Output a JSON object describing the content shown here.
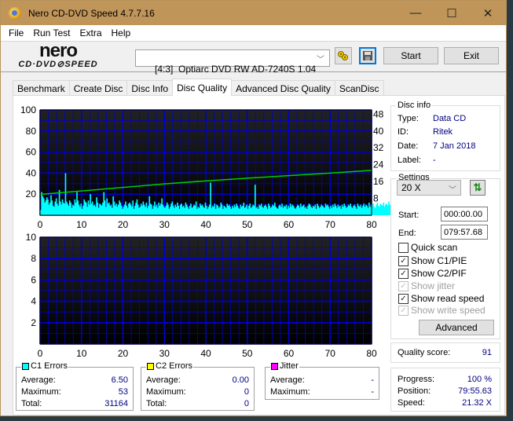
{
  "window": {
    "title": "Nero CD-DVD Speed 4.7.7.16",
    "controls": {
      "minimize": "—",
      "maximize": "☐",
      "close": "✕"
    }
  },
  "menu": [
    "File",
    "Run Test",
    "Extra",
    "Help"
  ],
  "toolbar": {
    "logo_top": "nero",
    "logo_bottom": "CD·DVD⊘SPEED",
    "drive": "[4:3]  Optiarc DVD RW AD-7240S 1.04",
    "start_label": "Start",
    "exit_label": "Exit",
    "icons": [
      "eject-icon",
      "save-icon"
    ]
  },
  "tabs": [
    {
      "label": "Benchmark",
      "active": false
    },
    {
      "label": "Create Disc",
      "active": false
    },
    {
      "label": "Disc Info",
      "active": false
    },
    {
      "label": "Disc Quality",
      "active": true
    },
    {
      "label": "Advanced Disc Quality",
      "active": false
    },
    {
      "label": "ScanDisc",
      "active": false
    }
  ],
  "disc_info": {
    "title": "Disc info",
    "type_label": "Type:",
    "type": "Data CD",
    "id_label": "ID:",
    "id": "Ritek",
    "date_label": "Date:",
    "date": "7 Jan 2018",
    "label_label": "Label:",
    "label": "-"
  },
  "settings": {
    "title": "Settings",
    "speed": "20 X",
    "start_label": "Start:",
    "start": "000:00.00",
    "end_label": "End:",
    "end": "079:57.68",
    "quick_scan": {
      "label": "Quick scan",
      "checked": false,
      "enabled": true
    },
    "show_c1": {
      "label": "Show C1/PIE",
      "checked": true,
      "enabled": true
    },
    "show_c2": {
      "label": "Show C2/PIF",
      "checked": true,
      "enabled": true
    },
    "show_jitter": {
      "label": "Show jitter",
      "checked": true,
      "enabled": false
    },
    "show_read": {
      "label": "Show read speed",
      "checked": true,
      "enabled": true
    },
    "show_write": {
      "label": "Show write speed",
      "checked": true,
      "enabled": false
    },
    "advanced_label": "Advanced"
  },
  "quality": {
    "label": "Quality score:",
    "value": "91"
  },
  "progress": {
    "progress_label": "Progress:",
    "progress": "100 %",
    "position_label": "Position:",
    "position": "79:55.63",
    "speed_label": "Speed:",
    "speed": "21.32 X"
  },
  "c1_errors": {
    "title": "C1 Errors",
    "color": "#00ffff",
    "avg_label": "Average:",
    "average": "6.50",
    "max_label": "Maximum:",
    "maximum": "53",
    "total_label": "Total:",
    "total": "31164"
  },
  "c2_errors": {
    "title": "C2 Errors",
    "color": "#ffff00",
    "avg_label": "Average:",
    "average": "0.00",
    "max_label": "Maximum:",
    "maximum": "0",
    "total_label": "Total:",
    "total": "0"
  },
  "jitter": {
    "title": "Jitter",
    "color": "#ff00ff",
    "avg_label": "Average:",
    "average": "-",
    "max_label": "Maximum:",
    "maximum": "-"
  },
  "chart_data": [
    {
      "type": "bar",
      "title": "C1 Errors / Read Speed",
      "x_range": [
        0,
        80
      ],
      "x_ticks": [
        "0",
        "10",
        "20",
        "30",
        "40",
        "50",
        "60",
        "70",
        "80"
      ],
      "y_left_range": [
        0,
        100
      ],
      "y_left_ticks": [
        "20",
        "40",
        "60",
        "80",
        "100"
      ],
      "y_right_range": [
        0,
        50
      ],
      "y_right_ticks": [
        "8",
        "16",
        "24",
        "32",
        "40",
        "48"
      ],
      "grid": true,
      "series": [
        {
          "name": "C1 Errors",
          "color": "#00ffff",
          "type": "bar",
          "x_step": 0.25,
          "values": [
            5,
            22,
            18,
            16,
            12,
            14,
            17,
            15,
            10,
            12,
            19,
            14,
            9,
            8,
            13,
            16,
            11,
            9,
            24,
            13,
            10,
            15,
            12,
            11,
            40,
            13,
            11,
            9,
            14,
            12,
            7,
            10,
            9,
            15,
            12,
            22,
            14,
            10,
            8,
            11,
            6,
            9,
            15,
            13,
            12,
            8,
            14,
            10,
            20,
            11,
            13,
            9,
            10,
            8,
            17,
            12,
            7,
            11,
            10,
            9,
            12,
            22,
            14,
            8,
            16,
            11,
            12,
            9,
            10,
            7,
            18,
            13,
            9,
            11,
            8,
            10,
            14,
            12,
            9,
            6,
            8,
            10,
            13,
            9,
            7,
            11,
            12,
            10,
            8,
            14,
            6,
            9,
            12,
            15,
            10,
            7,
            8,
            11,
            9,
            13,
            10,
            8,
            12,
            7,
            9,
            18,
            11,
            10,
            6,
            9,
            13,
            8,
            10,
            7,
            12,
            9,
            11,
            16,
            10,
            8,
            7,
            9,
            12,
            10,
            6,
            8,
            11,
            13,
            9,
            7,
            10,
            8,
            12,
            9,
            6,
            10,
            11,
            8,
            9,
            7,
            12,
            10,
            8,
            6,
            9,
            11,
            7,
            8,
            10,
            9,
            13,
            6,
            8,
            7,
            11,
            9,
            10,
            8,
            7,
            12,
            9,
            6,
            8,
            10,
            31,
            7,
            9,
            8,
            11,
            6,
            10,
            9,
            7,
            8,
            12,
            10,
            6,
            9,
            8,
            7,
            11,
            9,
            10,
            8,
            6,
            9,
            7,
            10,
            8,
            11,
            9,
            7,
            6,
            10,
            8,
            9,
            12,
            7,
            8,
            10,
            6,
            9,
            11,
            7,
            8,
            10,
            9,
            29,
            7,
            8,
            6,
            10,
            9,
            11,
            8,
            7,
            9,
            10,
            8,
            6,
            11,
            9,
            7,
            8,
            10,
            9,
            12,
            8,
            7,
            6,
            9,
            10,
            8,
            11,
            7,
            9,
            8,
            10,
            6,
            9,
            7,
            11,
            8,
            10,
            9,
            7,
            6,
            8,
            10,
            9,
            7,
            11,
            8,
            9,
            10,
            7,
            8,
            6,
            9,
            11,
            10,
            8,
            7,
            9,
            8,
            10,
            6,
            11,
            9,
            7,
            8,
            10,
            9,
            8,
            7,
            11,
            9,
            10,
            8,
            6,
            9,
            7,
            10,
            8,
            11,
            9,
            7,
            10,
            8,
            9,
            6,
            10,
            8,
            11,
            9,
            7,
            8,
            10,
            9,
            11,
            8,
            7,
            9,
            10,
            8,
            6,
            11,
            9,
            8,
            10,
            7,
            9,
            11,
            8,
            10,
            9,
            7,
            12,
            8,
            10,
            9,
            11,
            8,
            7,
            10,
            12,
            9,
            8,
            11,
            10,
            9,
            12,
            8,
            10,
            11,
            9,
            13,
            10,
            8,
            12,
            11,
            9,
            10,
            13,
            11,
            12,
            10,
            9,
            14,
            11,
            10,
            12,
            13,
            11,
            10,
            12,
            14,
            11,
            13,
            12,
            10,
            14,
            12,
            11,
            13,
            15,
            12,
            14,
            13,
            11,
            15,
            13,
            12,
            14,
            16,
            13,
            12,
            15,
            14,
            13,
            17,
            15,
            14,
            16,
            18,
            15,
            17,
            16,
            19,
            18,
            20,
            22,
            24,
            21,
            26,
            23,
            28,
            30,
            32,
            35,
            53,
            40,
            45,
            43
          ],
          "y_axis": "left"
        },
        {
          "name": "Read Speed",
          "color": "#00cc00",
          "type": "line",
          "points": [
            [
              0,
              9.9
            ],
            [
              10,
              11.5
            ],
            [
              20,
              13.2
            ],
            [
              30,
              14.9
            ],
            [
              40,
              16.3
            ],
            [
              50,
              17.6
            ],
            [
              60,
              18.8
            ],
            [
              70,
              20.0
            ],
            [
              80,
              21.3
            ]
          ],
          "y_axis": "right"
        }
      ]
    },
    {
      "type": "bar",
      "title": "C2 Errors",
      "x_range": [
        0,
        80
      ],
      "x_ticks": [
        "0",
        "10",
        "20",
        "30",
        "40",
        "50",
        "60",
        "70",
        "80"
      ],
      "y_range": [
        0,
        10
      ],
      "y_ticks": [
        "2",
        "4",
        "6",
        "8",
        "10"
      ],
      "grid": true,
      "series": [
        {
          "name": "C2 Errors",
          "color": "#ffff00",
          "values": []
        }
      ]
    }
  ]
}
